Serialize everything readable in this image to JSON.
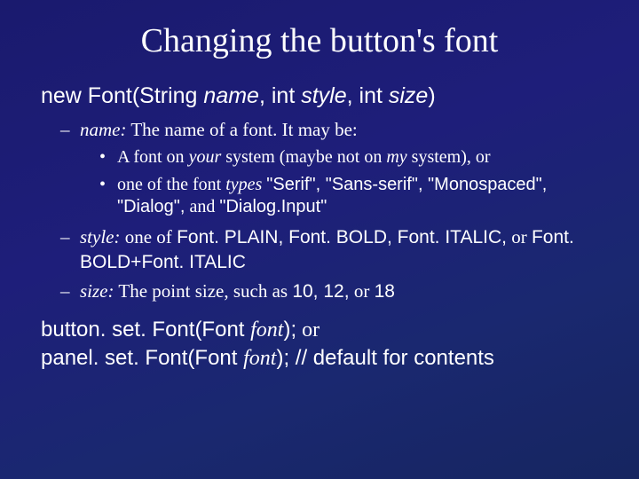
{
  "title": "Changing the button's font",
  "signature": {
    "pre": "new Font(String ",
    "p1": "name",
    "mid1": ", int ",
    "p2": "style",
    "mid2": ", int ",
    "p3": "size",
    "post": ")"
  },
  "items": {
    "name_label": "name:",
    "name_text": " The name of a font. It may be:",
    "sub1a": "A font on ",
    "sub1_your": "your",
    "sub1b": " system (maybe not on ",
    "sub1_my": "my",
    "sub1c": " system), or",
    "sub2a": "one of the font ",
    "sub2_types": "types",
    "sub2b": " ",
    "sub2_fonts": "\"Serif\", \"Sans-serif\", \"Monospaced\", \"Dialog\",",
    "sub2_and": " and ",
    "sub2_last": "\"Dialog.Input\"",
    "style_label": "style:",
    "style_text1": " one of ",
    "style_codes": "Font. PLAIN, Font. BOLD, Font. ITALIC,",
    "style_text2": " or ",
    "style_code2": "Font. BOLD+Font. ITALIC",
    "size_label": "size:",
    "size_text1": " The point size, such as ",
    "size_nums": "10, 12,",
    "size_text2": " or ",
    "size_last": "18"
  },
  "bottom": {
    "line1a": "button. set. Font(Font ",
    "line1_font": "font",
    "line1b": ");",
    "or": "   or",
    "line2a": "panel. set. Font(Font ",
    "line2_font": "font",
    "line2b": "); // default for contents"
  }
}
